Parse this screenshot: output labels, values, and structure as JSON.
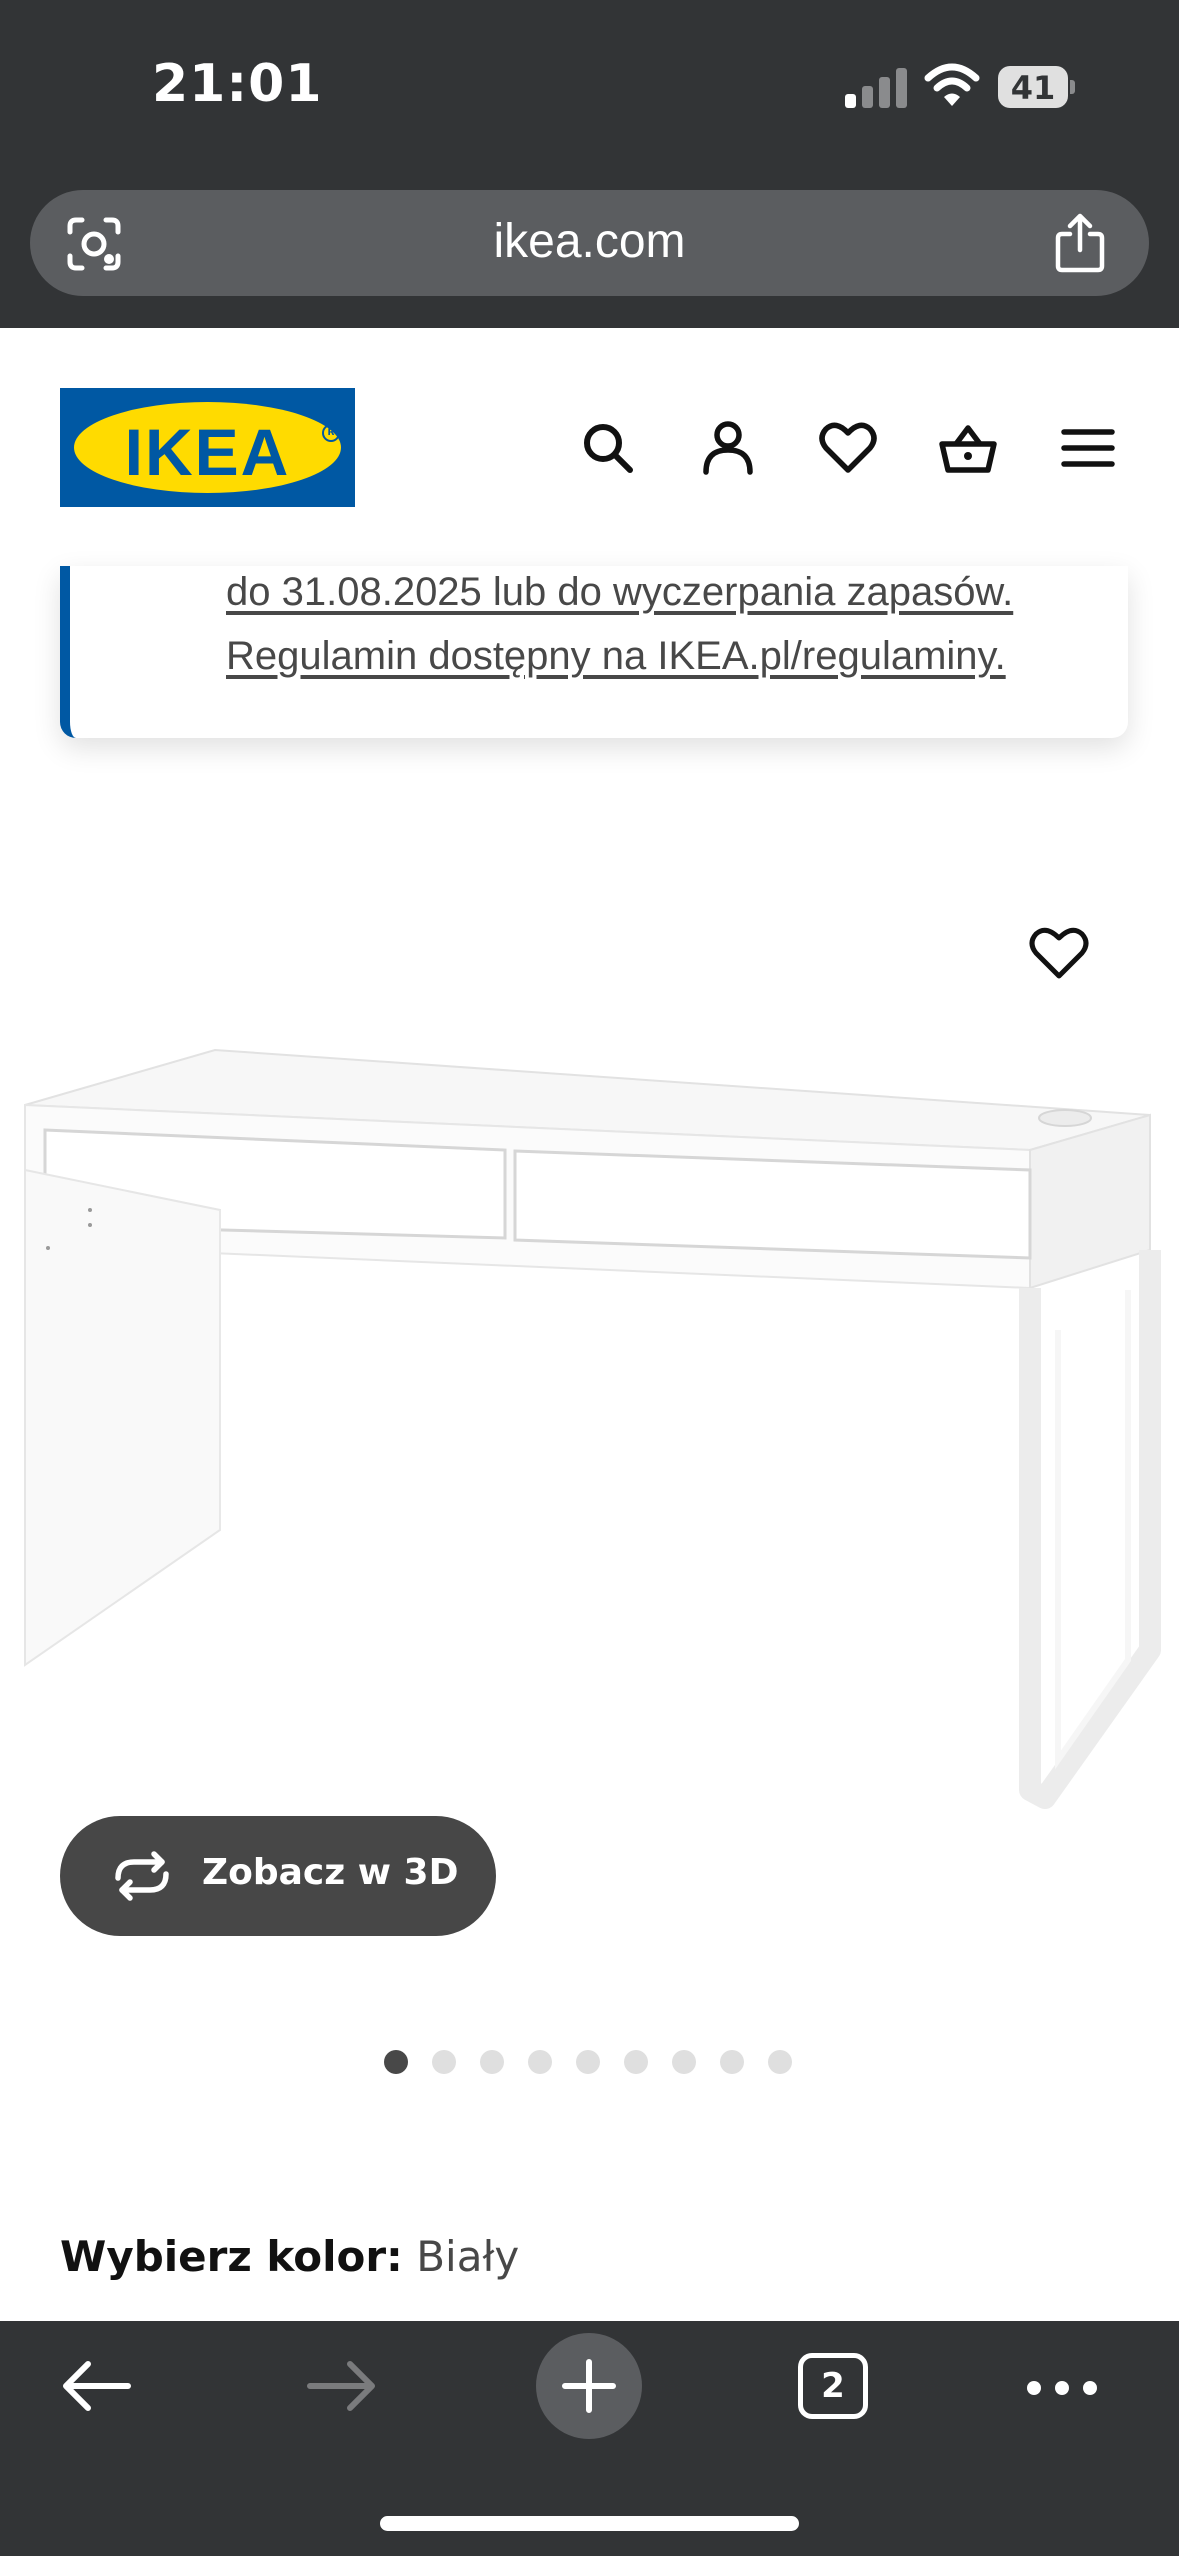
{
  "status_bar": {
    "time": "21:01",
    "battery": "41"
  },
  "browser": {
    "url": "ikea.com",
    "tab_count": "2"
  },
  "site": {
    "logo_text": "IKEA"
  },
  "promo": {
    "line1": "do 31.08.2025 lub do wyczerpania zapasów.",
    "line2": "Regulamin dostępny na IKEA.pl/regulaminy."
  },
  "product": {
    "view_3d_label": "Zobacz w 3D",
    "gallery": {
      "count": 9,
      "active_index": 0
    },
    "color_label": "Wybierz kolor:",
    "color_value": "Biały"
  },
  "colors": {
    "brand_blue": "#0058a3",
    "brand_yellow": "#ffdb00",
    "chrome": "#323436"
  }
}
